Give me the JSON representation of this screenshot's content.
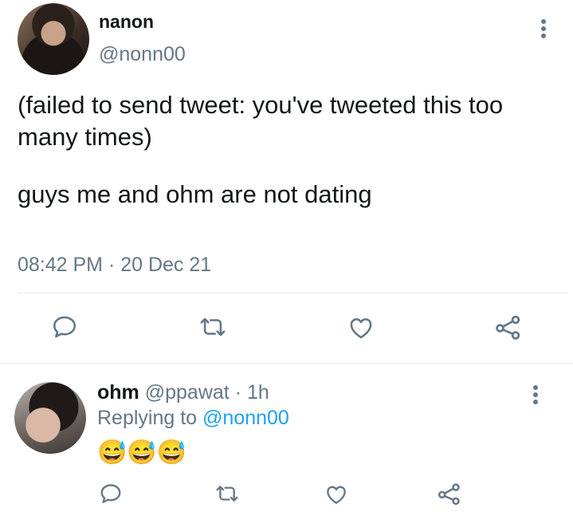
{
  "tweet": {
    "author_name": "nanon",
    "author_handle": "@nonn00",
    "text_line1": "(failed to send tweet: you've tweeted this too many times)",
    "text_line2": "guys me and ohm are not dating",
    "timestamp": "08:42 PM · 20 Dec 21"
  },
  "actions": {
    "icons": [
      "reply-icon",
      "retweet-icon",
      "like-icon",
      "share-icon"
    ]
  },
  "reply": {
    "author_name": "ohm",
    "author_handle": "@ppawat",
    "separator": "·",
    "time": "1h",
    "replying_prefix": "Replying to",
    "replying_to": "@nonn00",
    "emoji_text": "😅😅😅"
  },
  "colors": {
    "text": "#14171a",
    "secondary": "#657786",
    "link": "#1da1f2",
    "divider": "#e1e8ed"
  }
}
